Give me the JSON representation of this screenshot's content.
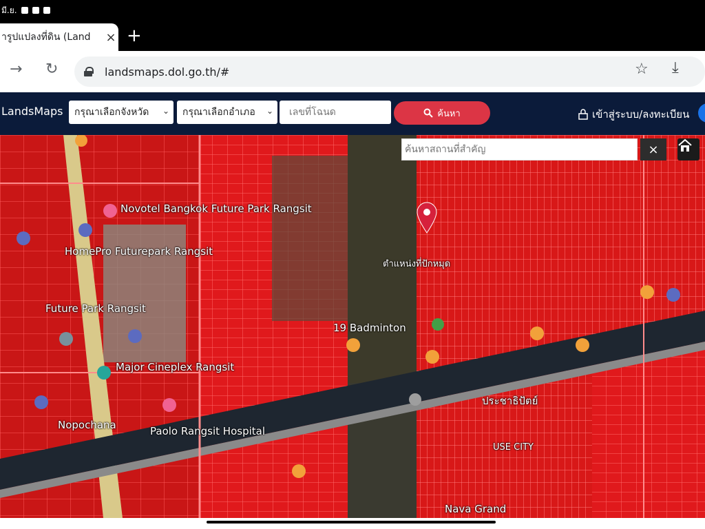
{
  "status_bar": {
    "time_text": "มี.ย."
  },
  "tab": {
    "title": "ารูปแปลงที่ดิน (Land",
    "close": "×",
    "new_tab": "+"
  },
  "toolbar": {
    "back": "←",
    "forward": "→",
    "reload": "↻",
    "url": "landsmaps.dol.go.th/#",
    "bookmark": "☆",
    "download": "⤓"
  },
  "navbar": {
    "brand": "LandsMaps",
    "province_select": "กรุณาเลือกจังหวัด",
    "district_select": "กรุณาเลือกอำเภอ",
    "deed_placeholder": "เลขที่โฉนด",
    "search_label": "ค้นหา",
    "login_label": "เข้าสู่ระบบ/ลงทะเบียน"
  },
  "map": {
    "place_search_placeholder": "ค้นหาสถานที่สำคัญ",
    "clear": "×",
    "labels": [
      "Novotel Bangkok Future Park Rangsit",
      "HomePro Futurepark Rangsit",
      "Future Park Rangsit",
      "Major Cineplex Rangsit",
      "Paolo Rangsit Hospital",
      "Nopochana",
      "19 Badminton",
      "ตำแหน่งที่ปักหมุด",
      "ประชาธิปัตย์",
      "Nava Grand",
      "USE CITY"
    ]
  },
  "colors": {
    "navbar": "#0b1b3a",
    "search_button": "#dc3545",
    "parcel_red": "#e11919",
    "pin_red": "#d6213c"
  },
  "icons": [
    "lock-icon",
    "star-icon",
    "download-icon",
    "search-icon",
    "user-lock-icon",
    "home-icon",
    "location-pin-icon"
  ]
}
